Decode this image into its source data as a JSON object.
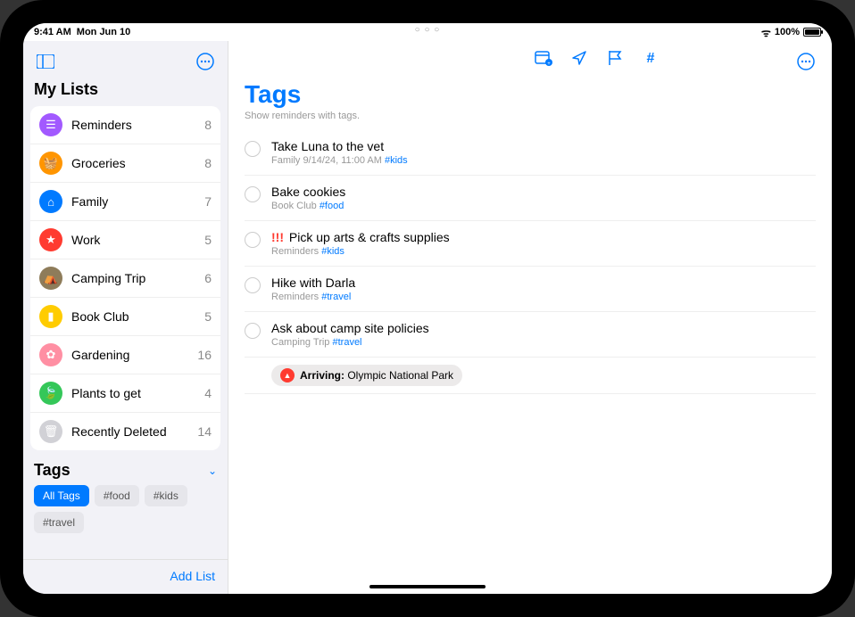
{
  "status": {
    "time": "9:41 AM",
    "date": "Mon Jun 10",
    "battery": "100%",
    "dots": "○ ○ ○"
  },
  "sidebar": {
    "title": "My Lists",
    "lists": [
      {
        "label": "Reminders",
        "count": "8",
        "color": "#a259ff",
        "icon": "☰"
      },
      {
        "label": "Groceries",
        "count": "8",
        "color": "#ff9500",
        "icon": "🧺"
      },
      {
        "label": "Family",
        "count": "7",
        "color": "#007aff",
        "icon": "⌂"
      },
      {
        "label": "Work",
        "count": "5",
        "color": "#ff3b30",
        "icon": "★"
      },
      {
        "label": "Camping Trip",
        "count": "6",
        "color": "#8e7c5a",
        "icon": "⛺"
      },
      {
        "label": "Book Club",
        "count": "5",
        "color": "#ffcc00",
        "icon": "▮"
      },
      {
        "label": "Gardening",
        "count": "16",
        "color": "#ff8fa3",
        "icon": "✿"
      },
      {
        "label": "Plants to get",
        "count": "4",
        "color": "#34c759",
        "icon": "🍃"
      },
      {
        "label": "Recently Deleted",
        "count": "14",
        "color": "#d1d1d6",
        "icon": "🗑"
      }
    ],
    "tagsTitle": "Tags",
    "tags": [
      {
        "label": "All Tags",
        "active": true
      },
      {
        "label": "#food",
        "active": false
      },
      {
        "label": "#kids",
        "active": false
      },
      {
        "label": "#travel",
        "active": false
      }
    ],
    "addList": "Add List"
  },
  "main": {
    "title": "Tags",
    "subtitle": "Show reminders with tags.",
    "reminders": [
      {
        "title": "Take Luna to the vet",
        "list": "Family",
        "meta": "9/14/24, 11:00 AM",
        "tag": "#kids",
        "priority": ""
      },
      {
        "title": "Bake cookies",
        "list": "Book Club",
        "meta": "",
        "tag": "#food",
        "priority": ""
      },
      {
        "title": "Pick up arts & crafts supplies",
        "list": "Reminders",
        "meta": "",
        "tag": "#kids",
        "priority": "!!!"
      },
      {
        "title": "Hike with Darla",
        "list": "Reminders",
        "meta": "",
        "tag": "#travel",
        "priority": ""
      },
      {
        "title": "Ask about camp site policies",
        "list": "Camping Trip",
        "meta": "",
        "tag": "#travel",
        "priority": "",
        "locationLabel": "Arriving:",
        "locationValue": "Olympic National Park"
      }
    ]
  }
}
